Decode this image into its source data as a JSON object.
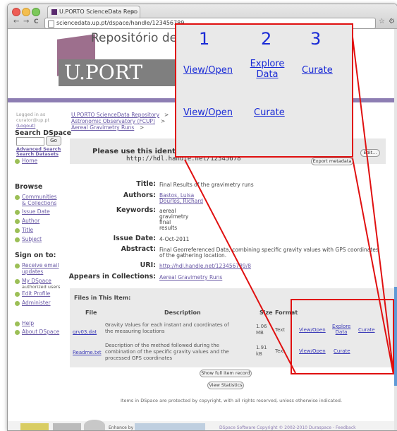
{
  "browser": {
    "tab_title": "U.PORTO ScienceData Repo",
    "tab_close": "×",
    "url": "sciencedata.up.pt/dspace/handle/123456789",
    "back": "←",
    "forward": "→",
    "reload": "C",
    "star": "☆",
    "wrench": "⚙"
  },
  "header": {
    "site_title": "Repositório de Dad",
    "logo_text": "U.PORT"
  },
  "sidebar": {
    "logged_in_line1": "Logged in as",
    "logged_in_line2": "curator@up.pt",
    "logout": "(Logout)",
    "search_heading": "Search DSpace",
    "go": "Go",
    "advanced_search": "Advanced Search",
    "search_datasets": "Search Datasets",
    "home": "Home",
    "browse_heading": "Browse",
    "communities": "Communities",
    "collections": "& Collections",
    "issue_date": "Issue Date",
    "author": "Author",
    "title": "Title",
    "subject": "Subject",
    "sign_on_heading": "Sign on to:",
    "receive_email": "Receive email",
    "updates": "updates",
    "my_dspace": "My DSpace",
    "authorized_users": "authorized users",
    "edit_profile": "Edit Profile",
    "administer": "Administer",
    "help": "Help",
    "about": "About DSpace"
  },
  "breadcrumb": {
    "item1": "U.PORTO ScienceData Repository",
    "sep": ">",
    "item2": "Astronomic Observatory (FCUP)",
    "item3": "Aereal Gravimetry Runs"
  },
  "identifier": {
    "title": "Please use this identifier",
    "url": "http://hdl.handle.net/12345678",
    "export": "Export metadata",
    "edit": "Edit..."
  },
  "record": {
    "title_label": "Title:",
    "title_value": "Final Results of the gravimetry runs",
    "authors_label": "Authors:",
    "author1": "Bastos, Luisa",
    "author2": "Dourlos, Richard",
    "keywords_label": "Keywords:",
    "kw1": "aereal",
    "kw2": "gravimetry",
    "kw3": "final",
    "kw4": "results",
    "issue_label": "Issue Date:",
    "issue_value": "4-Oct-2011",
    "abstract_label": "Abstract:",
    "abstract_line1": "Final Georreferenced Data, combining specific gravity values with GPS coordinates",
    "abstract_line2": "of the gathering location.",
    "uri_label": "URI:",
    "uri_value": "http://hdl.handle.net/123456789/8",
    "collections_label": "Appears in Collections:",
    "collections_value": "Aereal Gravimetry Runs"
  },
  "files": {
    "heading": "Files in This Item:",
    "columns": [
      "File",
      "Description",
      "Size",
      "Format"
    ],
    "rows": [
      {
        "file": "grv03.dat",
        "desc1": "Gravity Values for each instant and coordinates of",
        "desc2": "the measuring locations",
        "desc3": "",
        "size1": "1.06",
        "size2": "MB",
        "format": "Text",
        "view": "View/Open",
        "explore1": "Explore",
        "explore2": "Data",
        "curate": "Curate"
      },
      {
        "file": "Readme.txt",
        "desc1": "Description of the method followed during the",
        "desc2": "combination of the specific gravity values and the",
        "desc3": "processed GPS coordinates",
        "size1": "1.91",
        "size2": "kB",
        "format": "Text",
        "view": "View/Open",
        "curate": "Curate"
      }
    ],
    "show_full": "Show full item record",
    "view_stats": "View Statistics"
  },
  "footer": {
    "copyright": "Items in DSpace are protected by copyright, with all rights reserved, unless otherwise indicated.",
    "badge": "Enhance by",
    "dspace_text": "DSpace Software Copyright © 2002-2010 Duraspace - Feedback"
  },
  "callout": {
    "n1": "1",
    "n2": "2",
    "n3": "3",
    "view_open": "View/Open",
    "explore1": "Explore",
    "explore2": "Data",
    "curate": "Curate",
    "view_open2": "View/Open",
    "curate2": "Curate"
  },
  "colors": {
    "annotation_red": "#e01010",
    "link_blue": "#1a2bd6",
    "brand_purple": "#8d7eb3",
    "bullet_green": "#9cbf57"
  }
}
